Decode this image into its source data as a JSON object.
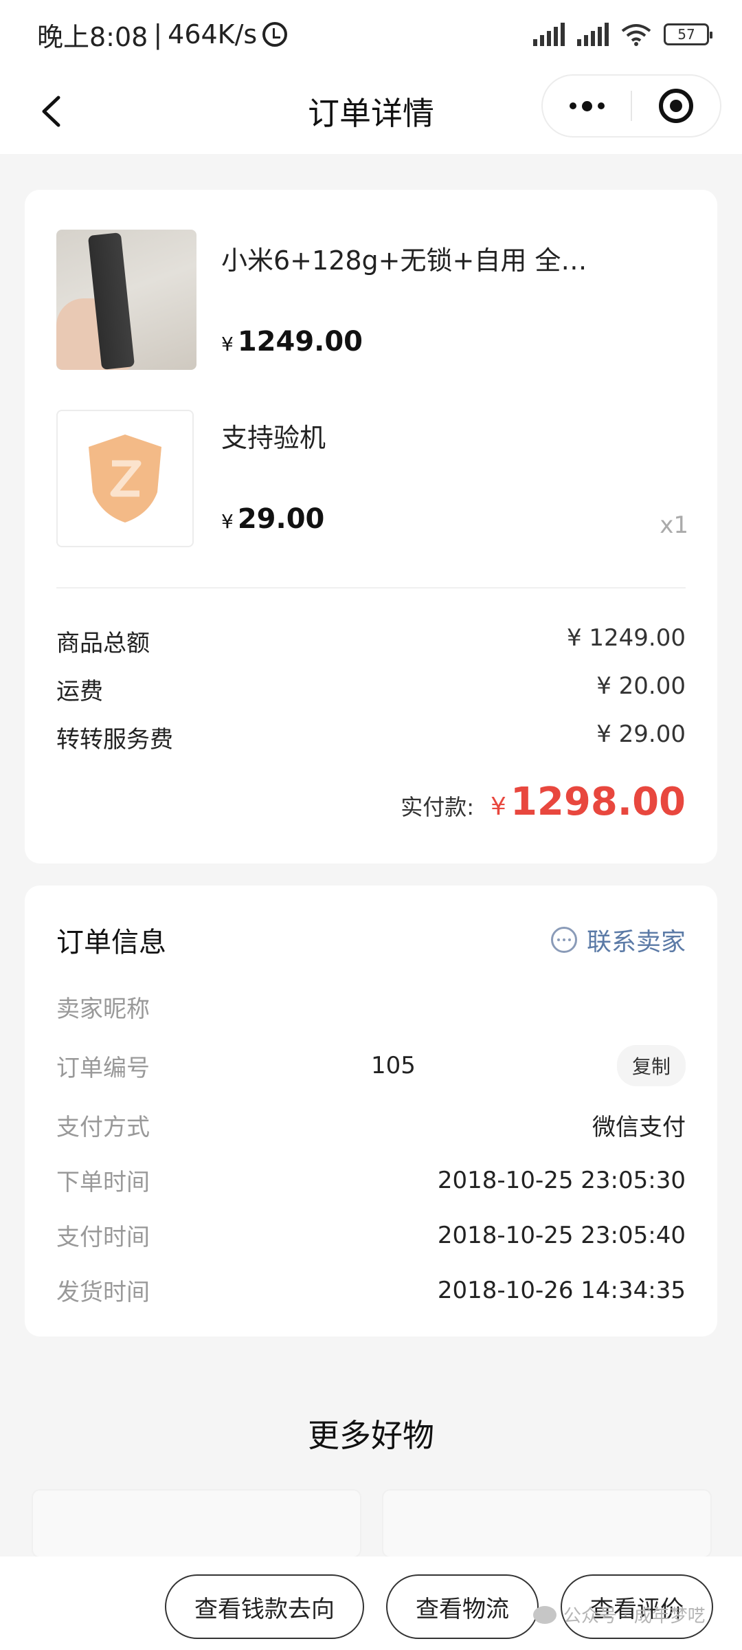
{
  "status_bar": {
    "time": "晚上8:08",
    "separator": "|",
    "speed": "464K/s",
    "battery": "57"
  },
  "nav": {
    "title": "订单详情"
  },
  "products": [
    {
      "title": "小米6+128g+无锁+自用 全…",
      "currency": "¥",
      "price": "1249.00"
    },
    {
      "title": "支持验机",
      "currency": "¥",
      "price": "29.00",
      "quantity": "x1"
    }
  ],
  "fees": [
    {
      "label": "商品总额",
      "value": "¥ 1249.00"
    },
    {
      "label": "运费",
      "value": "¥ 20.00"
    },
    {
      "label": "转转服务费",
      "value": "¥ 29.00"
    }
  ],
  "total": {
    "label": "实付款:",
    "currency": "¥",
    "amount": "1298.00"
  },
  "order_info": {
    "title": "订单信息",
    "contact_label": "联系卖家",
    "seller_label": "卖家昵称",
    "order_no_label": "订单编号",
    "order_no": "105",
    "copy_label": "复制",
    "payment_label": "支付方式",
    "payment_value": "微信支付",
    "order_time_label": "下单时间",
    "order_time": "2018-10-25 23:05:30",
    "pay_time_label": "支付时间",
    "pay_time": "2018-10-25 23:05:40",
    "ship_time_label": "发货时间",
    "ship_time": "2018-10-26 14:34:35"
  },
  "more_goods": {
    "title": "更多好物"
  },
  "actions": {
    "money_flow": "查看钱款去向",
    "logistics": "查看物流",
    "review": "查看评价"
  },
  "watermark": "公众号 · 成年梦呓",
  "colors": {
    "price_red": "#e8473e",
    "link_blue": "#5b7aa6",
    "shield_orange": "#f2b27a"
  }
}
